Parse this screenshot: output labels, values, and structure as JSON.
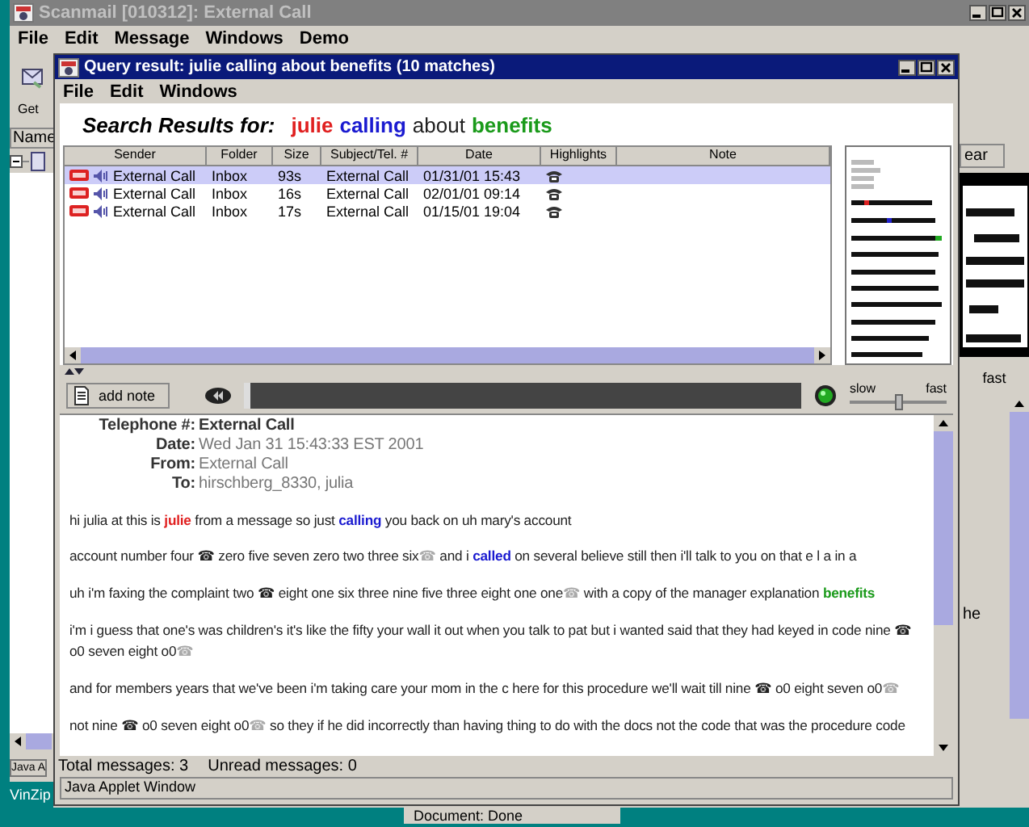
{
  "outer_window": {
    "title": "Scanmail [010312]: External Call",
    "menu": [
      "File",
      "Edit",
      "Message",
      "Windows",
      "Demo"
    ],
    "get_label": "Get",
    "tree_header": "Name",
    "right_button": "ear",
    "right_label": "fast",
    "right_text": "he",
    "status": "Java A",
    "taskbar_item": "VinZip",
    "browser_status": "Document: Done"
  },
  "query_window": {
    "title": "Query result: julie calling about benefits (10 matches)",
    "menu": [
      "File",
      "Edit",
      "Windows"
    ],
    "search": {
      "label": "Search Results for:",
      "terms": [
        {
          "text": "julie",
          "color": "#e02020"
        },
        {
          "text": "calling",
          "color": "#1a1ad0"
        },
        {
          "text": "about",
          "color": "#202020"
        },
        {
          "text": "benefits",
          "color": "#1a9a1a"
        }
      ]
    },
    "table": {
      "columns": [
        "Sender",
        "Folder",
        "Size",
        "Subject/Tel. #",
        "Date",
        "Highlights",
        "Note"
      ],
      "rows": [
        {
          "sender": "External Call",
          "folder": "Inbox",
          "size": "93s",
          "subject": "External Call",
          "date": "01/31/01 15:43",
          "selected": true
        },
        {
          "sender": "External Call",
          "folder": "Inbox",
          "size": "16s",
          "subject": "External Call",
          "date": "02/01/01 09:14",
          "selected": false
        },
        {
          "sender": "External Call",
          "folder": "Inbox",
          "size": "17s",
          "subject": "External Call",
          "date": "01/15/01 19:04",
          "selected": false
        }
      ]
    },
    "toolbar": {
      "add_note": "add note",
      "playback": {
        "level": 0
      },
      "speed": {
        "min_label": "slow",
        "max_label": "fast",
        "level": 0.5
      }
    },
    "message": {
      "headers": [
        {
          "label": "Telephone #:",
          "value": "External Call",
          "emphasized": true
        },
        {
          "label": "Date:",
          "value": "Wed Jan 31 15:43:33 EST 2001",
          "emphasized": false
        },
        {
          "label": "From:",
          "value": "External Call",
          "emphasized": false
        },
        {
          "label": "To:",
          "value": "hirschberg_8330, julia",
          "emphasized": false
        }
      ],
      "transcript": [
        {
          "segments": [
            {
              "kind": "text",
              "text": "hi julia at this is "
            },
            {
              "kind": "hit",
              "text": "julie",
              "color": "#e02020"
            },
            {
              "kind": "text",
              "text": " from a message so just "
            },
            {
              "kind": "hit",
              "text": "calling",
              "color": "#1a1ad0"
            },
            {
              "kind": "text",
              "text": " you back on uh mary's account"
            }
          ]
        },
        {
          "segments": [
            {
              "kind": "text",
              "text": "account number four "
            },
            {
              "kind": "phone",
              "text": "☎",
              "on": true
            },
            {
              "kind": "text",
              "text": " zero five seven zero two three six"
            },
            {
              "kind": "phone",
              "text": "☎",
              "on": false
            },
            {
              "kind": "text",
              "text": " and i "
            },
            {
              "kind": "hit",
              "text": "called",
              "color": "#1a1ad0"
            },
            {
              "kind": "text",
              "text": " on several believe still then i'll talk to you on that e l a in a"
            }
          ]
        },
        {
          "segments": [
            {
              "kind": "text",
              "text": "uh i'm faxing the complaint two "
            },
            {
              "kind": "phone",
              "text": "☎",
              "on": true
            },
            {
              "kind": "text",
              "text": " eight one six three nine five three eight one one"
            },
            {
              "kind": "phone",
              "text": "☎",
              "on": false
            },
            {
              "kind": "text",
              "text": " with a copy of the manager explanation "
            },
            {
              "kind": "hit",
              "text": "benefits",
              "color": "#1a9a1a"
            }
          ]
        },
        {
          "segments": [
            {
              "kind": "text",
              "text": "i'm i guess that one's was children's it's like the fifty your wall it out when you talk to pat but i wanted said that they had keyed in code nine "
            },
            {
              "kind": "phone",
              "text": "☎",
              "on": true
            },
            {
              "kind": "text",
              "text": " o0 seven eight o0"
            },
            {
              "kind": "phone",
              "text": "☎",
              "on": false
            }
          ]
        },
        {
          "segments": [
            {
              "kind": "text",
              "text": "and for members years that we've been i'm taking care your mom in the c here for this procedure we'll wait till nine "
            },
            {
              "kind": "phone",
              "text": "☎",
              "on": true
            },
            {
              "kind": "text",
              "text": " o0 eight seven o0"
            },
            {
              "kind": "phone",
              "text": "☎",
              "on": false
            }
          ]
        },
        {
          "segments": [
            {
              "kind": "text",
              "text": "not nine "
            },
            {
              "kind": "phone",
              "text": "☎",
              "on": true
            },
            {
              "kind": "text",
              "text": " o0 seven eight o0"
            },
            {
              "kind": "phone",
              "text": "☎",
              "on": false
            },
            {
              "kind": "text",
              "text": " so they if he did incorrectly than having thing to do with the docs not the code that was the procedure code"
            }
          ]
        }
      ]
    },
    "status": {
      "total": "Total messages: 3",
      "unread": "Unread messages: 0"
    },
    "applet_status": "Java Applet Window"
  }
}
